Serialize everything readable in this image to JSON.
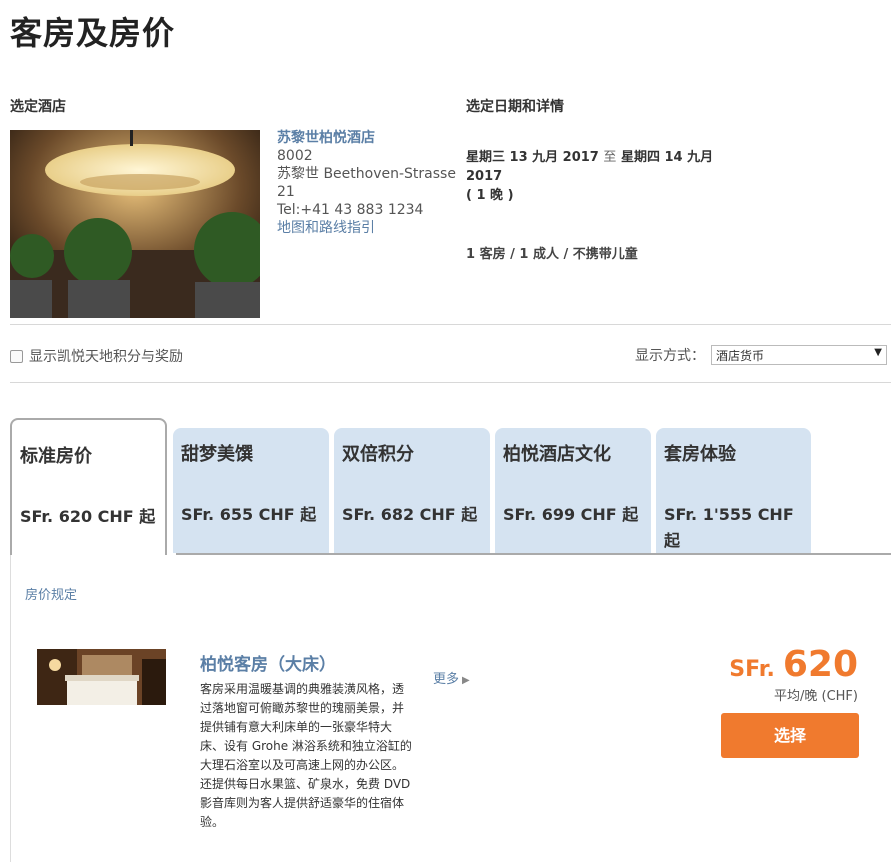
{
  "page_title": "客房及房价",
  "hotel_section_label": "选定酒店",
  "dates_section_label": "选定日期和详情",
  "hotel": {
    "name": "苏黎世柏悦酒店",
    "postcode": "8002",
    "address": "苏黎世 Beethoven-Strasse 21",
    "phone": "Tel:+41 43 883 1234",
    "map_link": "地图和路线指引"
  },
  "stay": {
    "checkin": "星期三 13 九月 2017",
    "to": "至",
    "checkout": "星期四 14 九月 2017",
    "nights": "( 1 晚 )",
    "guests": "1 客房 / 1 成人 / 不携带儿童"
  },
  "options": {
    "points_checkbox_label": "显示凯悦天地积分与奖励",
    "display_mode_label": "显示方式：",
    "display_mode_value": "酒店货币"
  },
  "tabs": [
    {
      "name": "标准房价",
      "price": "SFr. 620 CHF 起"
    },
    {
      "name": "甜梦美馔",
      "price": "SFr. 655 CHF 起"
    },
    {
      "name": "双倍积分",
      "price": "SFr. 682 CHF 起"
    },
    {
      "name": "柏悦酒店文化",
      "price": "SFr. 699 CHF 起"
    },
    {
      "name": "套房体验",
      "price": "SFr. 1'555 CHF 起"
    }
  ],
  "rate_rules_link": "房价规定",
  "room": {
    "name": "柏悦客房（大床）",
    "description": "客房采用温暖基调的典雅装潢风格，透过落地窗可俯瞰苏黎世的瑰丽美景，并提供铺有意大利床单的一张豪华特大床、设有 Grohe 淋浴系统和独立浴缸的大理石浴室以及可高速上网的办公区。 还提供每日水果篮、矿泉水，免费 DVD 影音库则为客人提供舒适豪华的住宿体验。",
    "more_link": "更多",
    "currency": "SFr.",
    "price": "620",
    "per_night": "平均/晚 (CHF)",
    "select_button": "选择"
  },
  "colors": {
    "accent": "#f07a2e",
    "link": "#5b7fa6",
    "tab_bg": "#d5e3f1"
  }
}
